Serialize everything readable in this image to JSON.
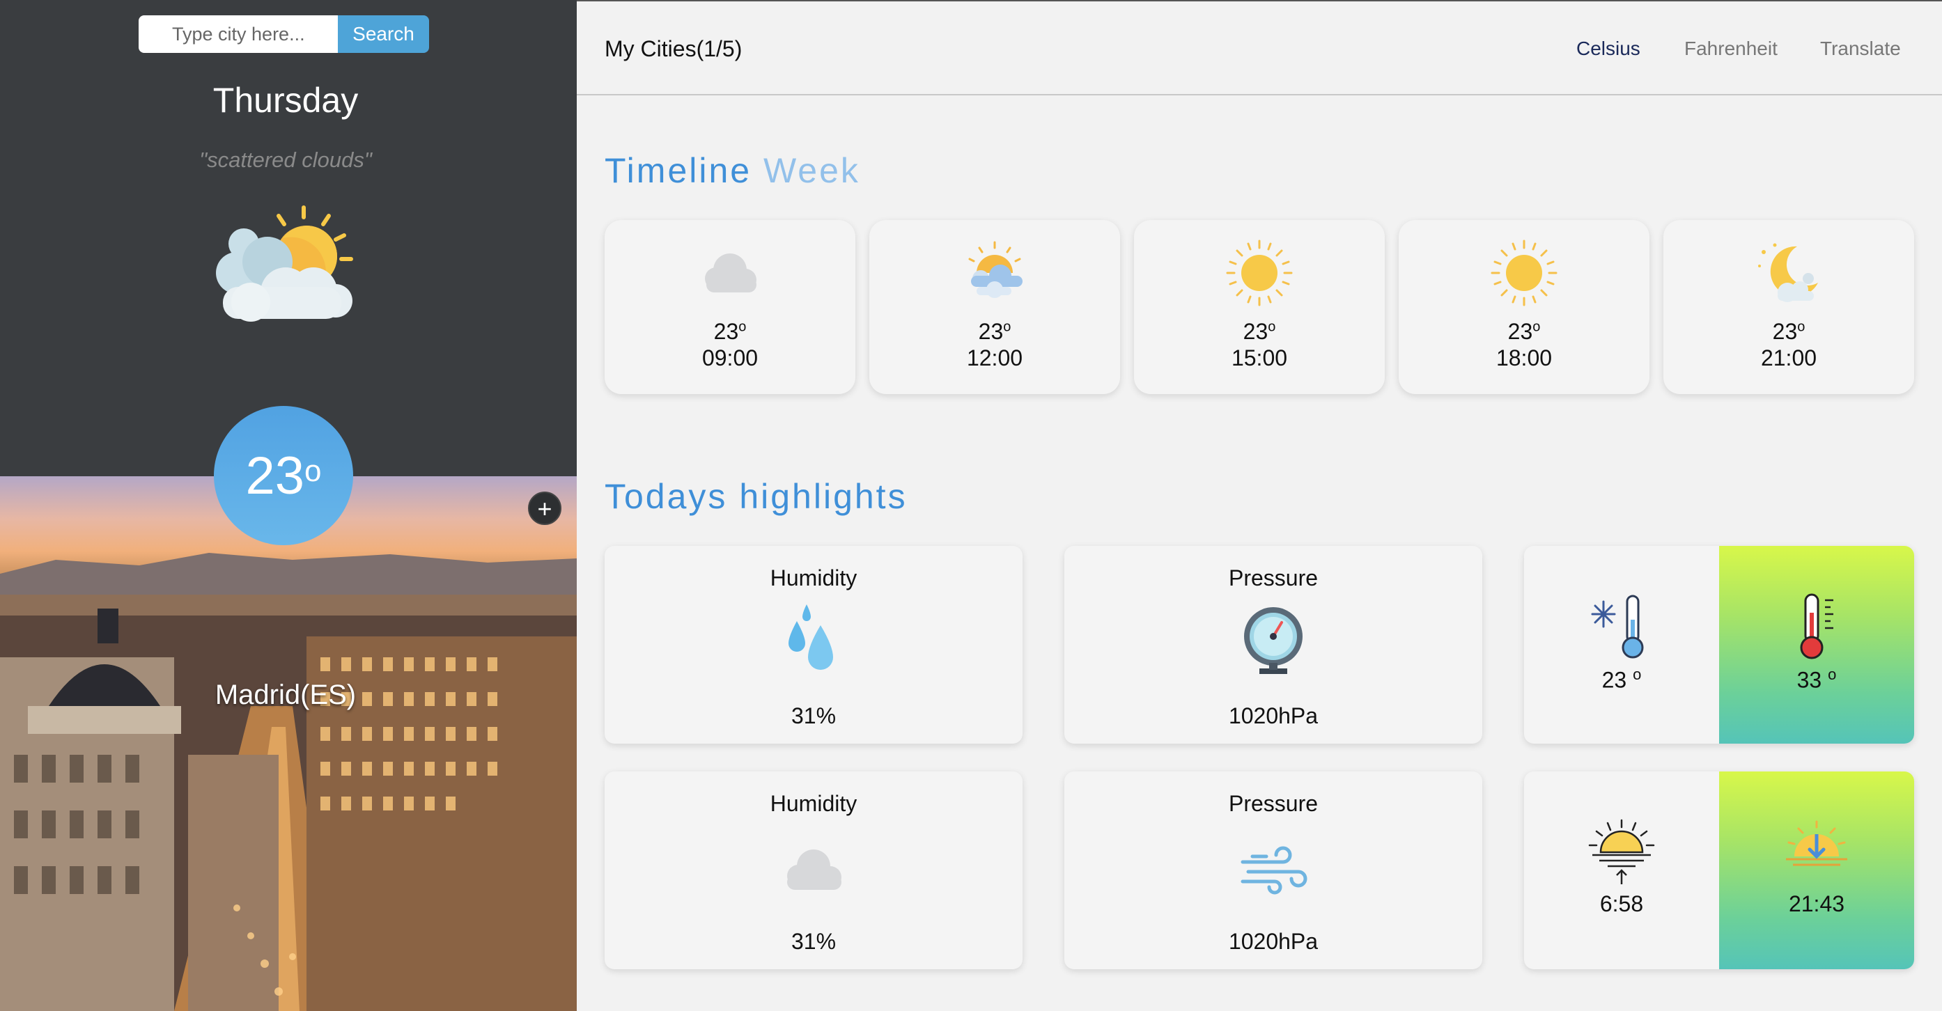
{
  "sidebar": {
    "search": {
      "placeholder": "Type city here...",
      "button_label": "Search"
    },
    "day": "Thursday",
    "description": "\"scattered clouds\"",
    "current_icon": "sun-behind-clouds-icon",
    "temperature": "23",
    "temperature_unit_mark": "o",
    "add_label": "+",
    "city": "Madrid(ES)"
  },
  "header": {
    "cities_label": "My Cities(1/5)",
    "nav": {
      "celsius": "Celsius",
      "fahrenheit": "Fahrenheit",
      "translate": "Translate"
    }
  },
  "timeline": {
    "title_main": "Timeline",
    "title_light": "Week",
    "items": [
      {
        "icon": "cloud-icon",
        "temp": "23",
        "mark": "o",
        "time": "09:00"
      },
      {
        "icon": "sun-behind-cloud-icon",
        "temp": "23",
        "mark": "o",
        "time": "12:00"
      },
      {
        "icon": "sun-icon",
        "temp": "23",
        "mark": "o",
        "time": "15:00"
      },
      {
        "icon": "sun-icon",
        "temp": "23",
        "mark": "o",
        "time": "18:00"
      },
      {
        "icon": "moon-cloud-icon",
        "temp": "23",
        "mark": "o",
        "time": "21:00"
      }
    ]
  },
  "highlights": {
    "title": "Todays highlights",
    "cards": [
      {
        "label": "Humidity",
        "icon": "water-drops-icon",
        "value": "31%"
      },
      {
        "label": "Pressure",
        "icon": "pressure-gauge-icon",
        "value": "1020hPa"
      },
      {
        "label": "Humidity",
        "icon": "cloud-icon",
        "value": "31%"
      },
      {
        "label": "Pressure",
        "icon": "wind-icon",
        "value": "1020hPa"
      }
    ],
    "temp_range": {
      "min": "23 ",
      "min_mark": "o",
      "max": "33 ",
      "max_mark": "o"
    },
    "sun": {
      "sunrise": "6:58",
      "sunset": "21:43"
    }
  },
  "colors": {
    "accent": "#3f8fd8",
    "accent_light": "#92c0ea",
    "sidebar_bg": "#3a3d40",
    "search_button": "#4ea4d8"
  }
}
